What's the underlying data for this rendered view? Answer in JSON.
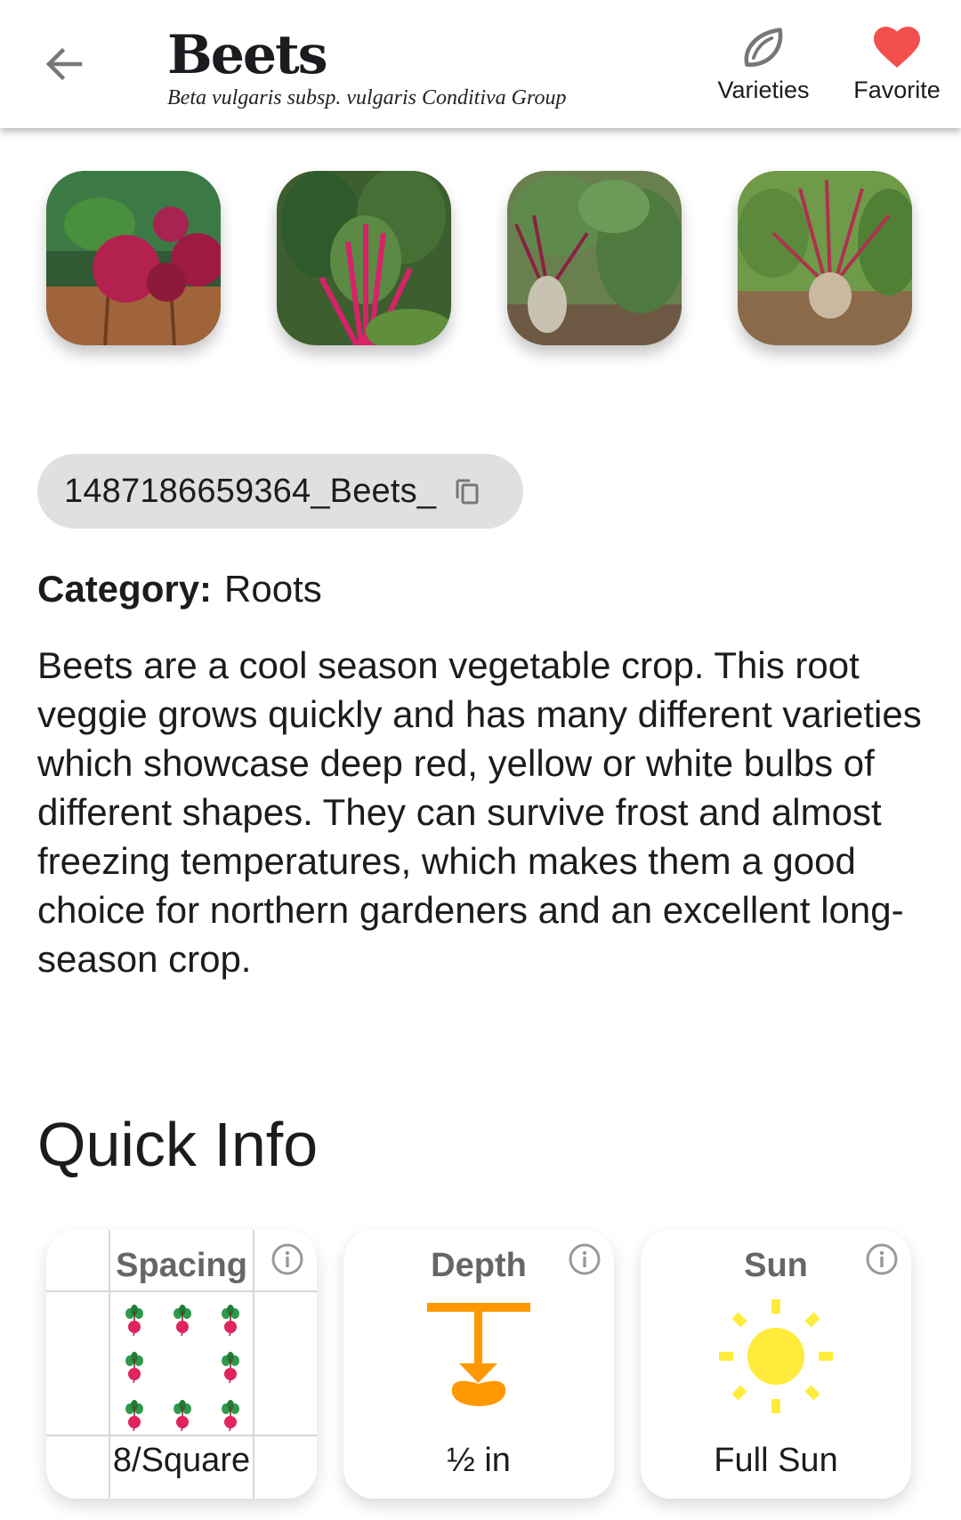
{
  "header": {
    "title": "Beets",
    "subtitle": "Beta vulgaris subsp. vulgaris Conditiva Group",
    "back_icon": "arrow-left-icon",
    "actions": [
      {
        "label": "Varieties",
        "icon": "leaf-icon"
      },
      {
        "label": "Favorite",
        "icon": "heart-icon"
      }
    ]
  },
  "gallery": {
    "photos": [
      {
        "alt": "Harvested red beets on wooden table"
      },
      {
        "alt": "Red-stemmed beet leaves"
      },
      {
        "alt": "Beet plant growing in garden"
      },
      {
        "alt": "Beet root emerging from soil"
      }
    ]
  },
  "plant_id": {
    "text": "1487186659364_Beets_",
    "icon": "copy-icon"
  },
  "category": {
    "label": "Category:",
    "value": "Roots"
  },
  "description": "Beets are a cool season vegetable crop. This root veggie grows quickly and has many different varieties which showcase deep red, yellow or white bulbs of different shapes. They can survive frost and almost freezing temperatures, which makes them a good choice for northern gardeners and an excellent long-season crop.",
  "quick_info": {
    "title": "Quick Info",
    "cards": [
      {
        "title": "Spacing",
        "value": "8/Square",
        "icon": "beet-grid-icon",
        "plants_per_square": 8
      },
      {
        "title": "Depth",
        "value": "½ in",
        "icon": "seed-depth-icon"
      },
      {
        "title": "Sun",
        "value": "Full Sun",
        "icon": "sun-icon"
      }
    ]
  },
  "colors": {
    "favorite": "#f44f4f",
    "chip_bg": "#e0e0e0",
    "depth_orange": "#ff9800",
    "sun_yellow": "#ffeb3b",
    "beet_red": "#e0245e",
    "beet_leaf": "#2e9a48"
  }
}
